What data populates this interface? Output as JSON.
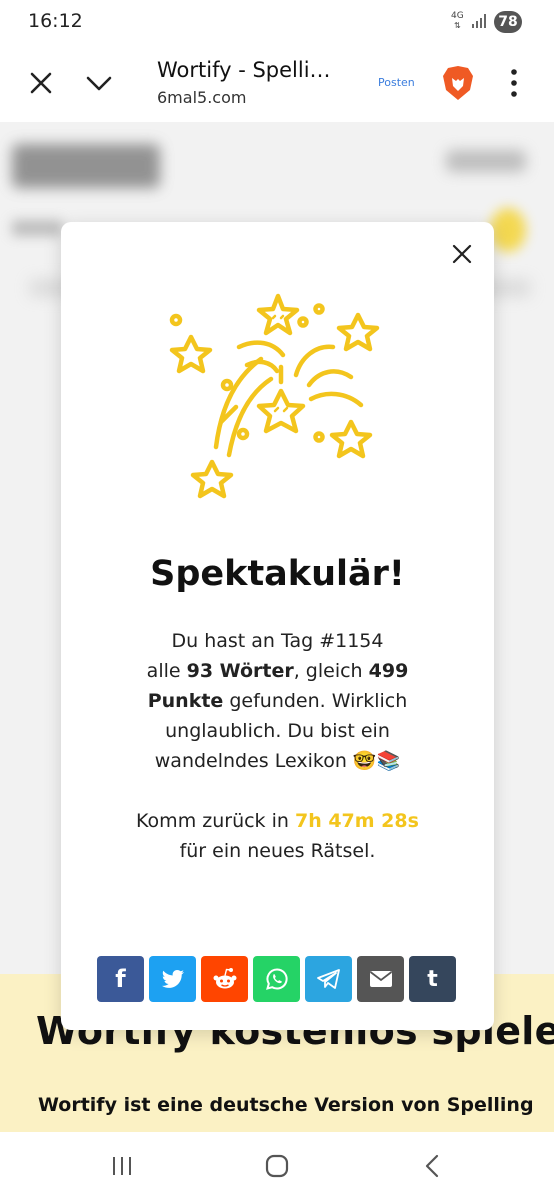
{
  "status": {
    "time": "16:12",
    "network": "4G",
    "battery": "78"
  },
  "toolbar": {
    "title": "Wortify - Spelli…",
    "url": "6mal5.com",
    "posten_label": "Posten",
    "icons": [
      "close-icon",
      "chevron-down-icon",
      "brave-lion-icon",
      "more-vert-icon"
    ]
  },
  "background_page": {
    "heading": "Wortify kostenlos spielen",
    "text": "Wortify ist eine deutsche Version von Spelling",
    "band_color": "#fbf1c4"
  },
  "modal": {
    "title": "Spektakulär!",
    "line1": "Du hast an Tag #1154",
    "line2_pre": "alle ",
    "words_count": "93 Wörter",
    "line2_mid": ", gleich ",
    "points_value": "499",
    "points_label": "Punkte",
    "line3": " gefunden. Wirklich unglaublich. Du bist ein wandelndes Lexikon 🤓📚",
    "comeback_pre": "Komm zurück in ",
    "countdown": "7h 47m 28s",
    "comeback_post": " für ein neues Rätsel.",
    "accent_color": "#f3c51d",
    "share_buttons": [
      {
        "name": "facebook",
        "glyph": "f",
        "color": "#3b5998"
      },
      {
        "name": "twitter",
        "glyph": "",
        "color": "#1da1f2"
      },
      {
        "name": "reddit",
        "glyph": "",
        "color": "#ff4500"
      },
      {
        "name": "whatsapp",
        "glyph": "",
        "color": "#25d366"
      },
      {
        "name": "telegram",
        "glyph": "",
        "color": "#2ca5e0"
      },
      {
        "name": "email",
        "glyph": "",
        "color": "#555555"
      },
      {
        "name": "tumblr",
        "glyph": "t",
        "color": "#35465c"
      }
    ]
  },
  "navbar": {
    "icons": [
      "recent-apps-icon",
      "home-icon",
      "back-icon"
    ]
  }
}
